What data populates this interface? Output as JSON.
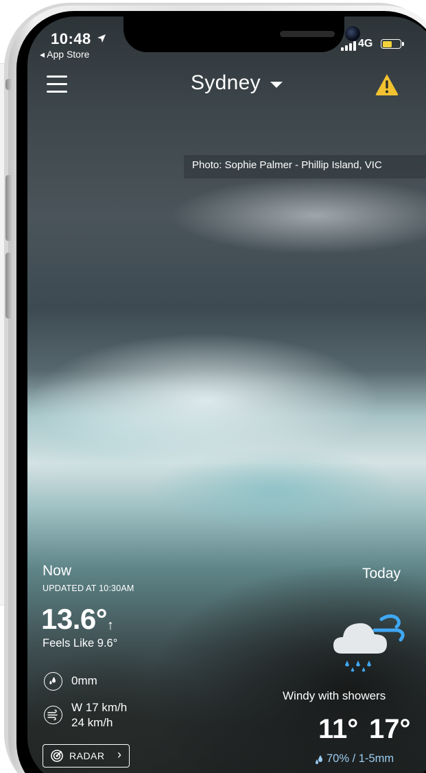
{
  "status_bar": {
    "time": "10:48",
    "time_icon": "location-arrow-icon",
    "back_label": "◂ App Store",
    "network": "4G",
    "battery_level": 0.52,
    "battery_color": "#f3d23b"
  },
  "header": {
    "menu_icon": "hamburger-menu-icon",
    "city": "Sydney",
    "dropdown_icon": "caret-down-icon",
    "warning_icon": "warning-triangle-icon",
    "warning_color": "#f2c230"
  },
  "photo_credit": "Photo: Sophie Palmer - Phillip Island, VIC",
  "now": {
    "label": "Now",
    "updated": "UPDATED AT 10:30AM",
    "temperature": "13.6°",
    "trend": "↑",
    "feels_like": "Feels Like 9.6°",
    "rainfall": "0mm",
    "wind_line1": "W 17 km/h",
    "wind_line2": "24 km/h"
  },
  "radar": {
    "label": "RADAR",
    "chevron": "›"
  },
  "today": {
    "label": "Today",
    "icon": "cloud-rain-wind-icon",
    "condition": "Windy with showers",
    "min": "11°",
    "max": "17°",
    "precip": "70% / 1-5mm",
    "precip_color": "#9bcdf2"
  }
}
